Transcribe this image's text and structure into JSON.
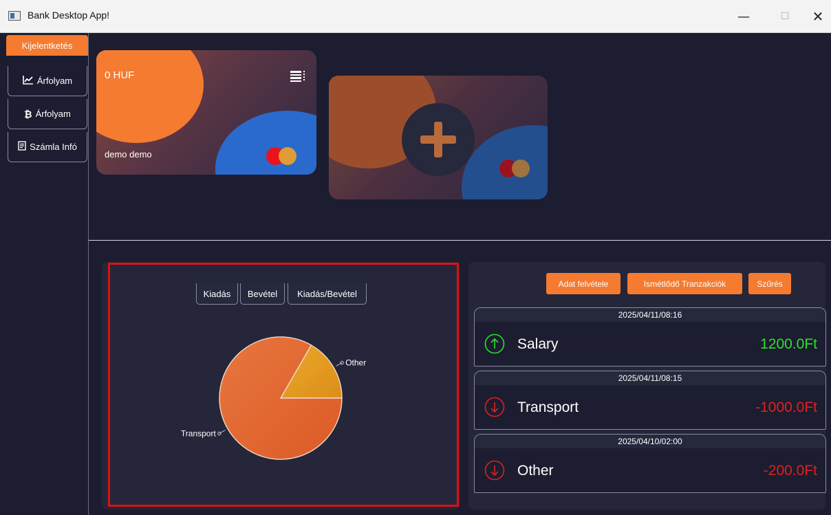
{
  "window": {
    "title": "Bank Desktop App!",
    "minimize": "—",
    "maximize": "☐",
    "close": "✕"
  },
  "sidebar": {
    "logout_label": "Kijelentketés",
    "items": [
      {
        "icon": "line-chart-icon",
        "glyph": "📈",
        "label": "Árfolyam"
      },
      {
        "icon": "bitcoin-icon",
        "glyph": "₿",
        "label": "Árfolyam"
      },
      {
        "icon": "document-icon",
        "glyph": "▤",
        "label": "Számla Infó"
      }
    ]
  },
  "cards": {
    "main": {
      "balance": "0 HUF",
      "holder": "demo demo"
    }
  },
  "chart": {
    "tabs": [
      "Kiadás",
      "Bevétel",
      "Kiadás/Bevétel"
    ],
    "colors": {
      "transport": "#e8673a",
      "other": "#e8a020"
    }
  },
  "chart_data": {
    "type": "pie",
    "slices": [
      {
        "label": "Transport",
        "value": 1000
      },
      {
        "label": "Other",
        "value": 200
      }
    ]
  },
  "transactions": {
    "buttons": [
      "Adat felvétele",
      "Ismétlődő Tranzakciók",
      "Szűrés"
    ],
    "items": [
      {
        "date": "2025/04/11/08:16",
        "name": "Salary",
        "amount": "1200.0Ft",
        "direction": "up",
        "color": "#2ee02e"
      },
      {
        "date": "2025/04/11/08:15",
        "name": "Transport",
        "amount": "-1000.0Ft",
        "direction": "down",
        "color": "#e02020"
      },
      {
        "date": "2025/04/10/02:00",
        "name": "Other",
        "amount": "-200.0Ft",
        "direction": "down",
        "color": "#e02020"
      }
    ]
  }
}
